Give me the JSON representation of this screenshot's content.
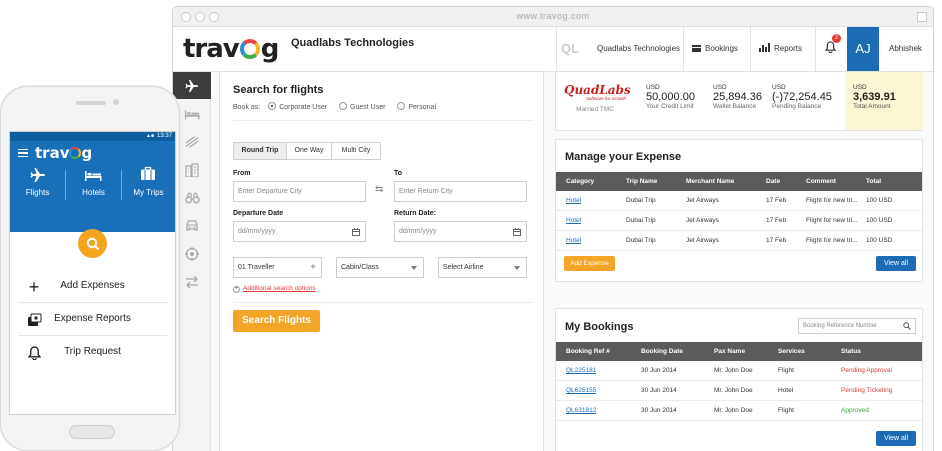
{
  "browser": {
    "url": "www.travog.com"
  },
  "header": {
    "logo_left": "trav",
    "logo_right": "g",
    "company": "Quadlabs Technologies",
    "ql_badge": "QL",
    "company_menu": "Quadlabs Technologies",
    "bookings": "Bookings",
    "reports": "Reports",
    "notifications_count": "2",
    "avatar": "AJ",
    "user_name": "Abhishek"
  },
  "sidebar": {
    "items": [
      {
        "icon": "plane-icon"
      },
      {
        "icon": "bed-icon"
      },
      {
        "icon": "train-icon"
      },
      {
        "icon": "building-icon"
      },
      {
        "icon": "binoculars-icon"
      },
      {
        "icon": "car-icon"
      },
      {
        "icon": "target-icon"
      },
      {
        "icon": "exchange-icon"
      }
    ]
  },
  "flights": {
    "title": "Search for flights",
    "book_as_label": "Book as:",
    "book_as_options": [
      "Corporate User",
      "Guest User",
      "Personal"
    ],
    "trip_types": [
      "Round Trip",
      "One Way",
      "Multi City"
    ],
    "from_label": "From",
    "from_placeholder": "Enter Departure City",
    "to_label": "To",
    "to_placeholder": "Enter Return City",
    "departure_label": "Departure Date",
    "departure_placeholder": "dd/mm/yyyy",
    "return_label": "Return Date:",
    "return_placeholder": "dd/mm/yyyy",
    "traveller": "01 Traveller",
    "cabin": "Cabin/Class",
    "airline": "Select Airline",
    "additional": "Additional search options",
    "search_button": "Search Flights"
  },
  "summary": {
    "brand": "QuadLabs",
    "brand_tagline": "Software for Growth",
    "brand_sub": "Married TMC",
    "stats": [
      {
        "currency": "USD",
        "value": "50,000.00",
        "label": "Your Credit Limit"
      },
      {
        "currency": "USD",
        "value": "25,894.36",
        "label": "Wallet Balance"
      },
      {
        "currency": "USD",
        "value": "(-)72,254.45",
        "label": "Pending Balance"
      },
      {
        "currency": "USD",
        "value": "3,639.91",
        "label": "Total Amount"
      }
    ]
  },
  "expense": {
    "title": "Manage your Expense",
    "columns": [
      "Category",
      "Trip Name",
      "Merchant Name",
      "Date",
      "Comment",
      "Total"
    ],
    "rows": [
      [
        "Hotel",
        "Dubai Trip",
        "Jet Airways",
        "17 Feb",
        "Flight for new tri...",
        "100 USD"
      ],
      [
        "Hotel",
        "Dubai Trip",
        "Jet Airways",
        "17 Feb",
        "Flight for new tri...",
        "100 USD"
      ],
      [
        "Hotel",
        "Dubai Trip",
        "Jet Airways",
        "17 Feb",
        "Flight for new tri...",
        "100 USD"
      ]
    ],
    "add_button": "Add Expense",
    "view_all": "View all"
  },
  "bookings": {
    "title": "My Bookings",
    "search_placeholder": "Booking Reference Number",
    "columns": [
      "Booking Ref #",
      "Booking Date",
      "Pax Name",
      "Services",
      "Status"
    ],
    "rows": [
      [
        "QL225181",
        "30 Jun 2014",
        "Mr. John Doe",
        "Flight",
        "Pending Approval"
      ],
      [
        "QL625155",
        "30 Jun 2014",
        "Mr. John Doe",
        "Hotel",
        "Pending Ticketing"
      ],
      [
        "QL631812",
        "30 Jun 2014",
        "Mr. John Doe",
        "Flight",
        "Approved"
      ]
    ],
    "status_colors": [
      "#e03b3b",
      "#e03b3b",
      "#3aa23a"
    ],
    "view_all": "View all"
  },
  "phone": {
    "time": "13:37",
    "logo_left": "trav",
    "logo_right": "g",
    "nav": [
      "Flights",
      "Hotels",
      "My Trips"
    ],
    "menu": [
      "Add Expenses",
      "Expense Reports",
      "Trip Request"
    ]
  }
}
